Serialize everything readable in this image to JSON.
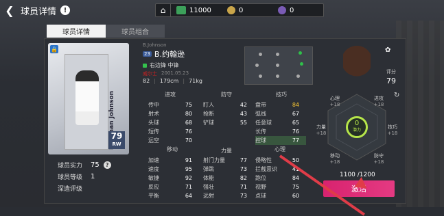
{
  "topbar": {
    "back_icon": "back-arrow-icon",
    "title": "球员详情",
    "info_symbol": "!",
    "currencies": [
      {
        "icon": "cash-icon",
        "value": "11000"
      },
      {
        "icon": "coin-icon",
        "value": "0"
      },
      {
        "icon": "gem-icon",
        "value": "0"
      }
    ]
  },
  "tabs": [
    {
      "label": "球员详情",
      "active": true
    },
    {
      "label": "球员组合",
      "active": false
    }
  ],
  "card": {
    "name": "Brennan Johnson",
    "rating": "79",
    "position": "RW"
  },
  "meta": {
    "strength_label": "球员实力",
    "strength_value": "75",
    "level_label": "球员等级",
    "level_value": "1",
    "deep_label": "深造评级",
    "help_symbol": "?"
  },
  "player": {
    "name_en": "B.Johnson",
    "number": "23",
    "name_cn": "B.约翰逊",
    "position_text": "右边锋 中锋",
    "nation": "威尔士",
    "birthdate": "2001.05.23",
    "rating_small": "82",
    "height": "179cm",
    "weight": "71kg",
    "score_label": "评分",
    "score_value": "79"
  },
  "stats_headers": {
    "attack": "进攻",
    "defense": "防守",
    "skill": "技巧",
    "movement": "移动",
    "power": "力量",
    "mental": "心理"
  },
  "stats": {
    "attack": [
      {
        "k": "传中",
        "v": "75"
      },
      {
        "k": "射术",
        "v": "80"
      },
      {
        "k": "头球",
        "v": "68"
      },
      {
        "k": "短传",
        "v": "76"
      },
      {
        "k": "远空",
        "v": "70"
      }
    ],
    "defense": [
      {
        "k": "盯人",
        "v": "42"
      },
      {
        "k": "抢断",
        "v": "43"
      },
      {
        "k": "铲球",
        "v": "55"
      }
    ],
    "skill": [
      {
        "k": "盘带",
        "v": "84"
      },
      {
        "k": "弧线",
        "v": "67"
      },
      {
        "k": "任意球",
        "v": "65"
      },
      {
        "k": "长传",
        "v": "76"
      },
      {
        "k": "控球",
        "v": "77"
      }
    ],
    "movement": [
      {
        "k": "加速",
        "v": "91"
      },
      {
        "k": "速度",
        "v": "95"
      },
      {
        "k": "敏捷",
        "v": "92"
      },
      {
        "k": "反应",
        "v": "71"
      },
      {
        "k": "平衡",
        "v": "64"
      }
    ],
    "power": [
      {
        "k": "射门力量",
        "v": "77"
      },
      {
        "k": "弹跳",
        "v": "73"
      },
      {
        "k": "体能",
        "v": "82"
      },
      {
        "k": "强壮",
        "v": "71"
      },
      {
        "k": "远射",
        "v": "73"
      }
    ],
    "mental": [
      {
        "k": "侵略性",
        "v": "50"
      },
      {
        "k": "拦截意识",
        "v": "41"
      },
      {
        "k": "跑位",
        "v": "84"
      },
      {
        "k": "视野",
        "v": "75"
      },
      {
        "k": "点球",
        "v": "60"
      }
    ]
  },
  "radar": {
    "labels": [
      {
        "name": "心理",
        "plus": "+18"
      },
      {
        "name": "进攻",
        "plus": "+18"
      },
      {
        "name": "力量",
        "plus": "+18"
      },
      {
        "name": "技巧",
        "plus": "+18"
      },
      {
        "name": "移动",
        "plus": "+18"
      },
      {
        "name": "防守",
        "plus": "+18"
      }
    ],
    "center_value": "0",
    "center_label": "潜力"
  },
  "exp_text": "1100 /1200",
  "train_label": "激活",
  "colors": {
    "accent_pink": "#e43a82",
    "green": "#b6e64a",
    "highlight": "#ffcc33",
    "arrow": "#e03c48"
  }
}
